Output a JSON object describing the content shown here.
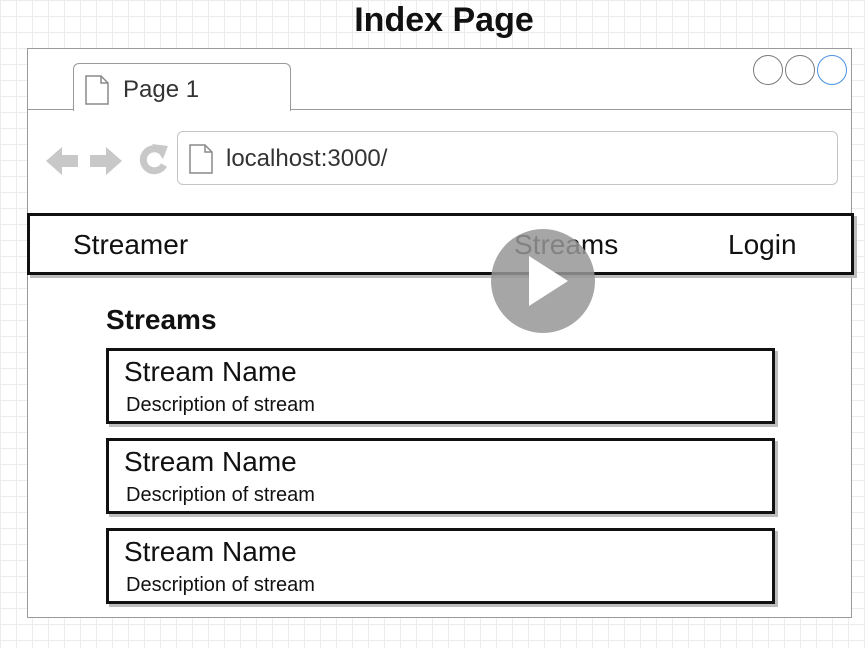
{
  "page": {
    "title": "Index Page"
  },
  "browser": {
    "tab_label": "Page 1",
    "url": "localhost:3000/",
    "window_controls": [
      "close-circle",
      "minimize-circle",
      "maximize-circle"
    ],
    "nav_icons": [
      "back-arrow-icon",
      "forward-arrow-icon",
      "reload-icon"
    ]
  },
  "navbar": {
    "brand": "Streamer",
    "links": [
      "Streams",
      "Login"
    ]
  },
  "content": {
    "heading": "Streams",
    "streams": [
      {
        "name": "Stream Name",
        "description": "Description of stream"
      },
      {
        "name": "Stream Name",
        "description": "Description of stream"
      },
      {
        "name": "Stream Name",
        "description": "Description of stream"
      }
    ]
  },
  "overlay": {
    "icon": "play-icon"
  },
  "colors": {
    "frame_gray": "#9a9a9a",
    "maximize_blue": "#4a90e2",
    "mockup_border": "#111111",
    "play_overlay": "#969696"
  }
}
